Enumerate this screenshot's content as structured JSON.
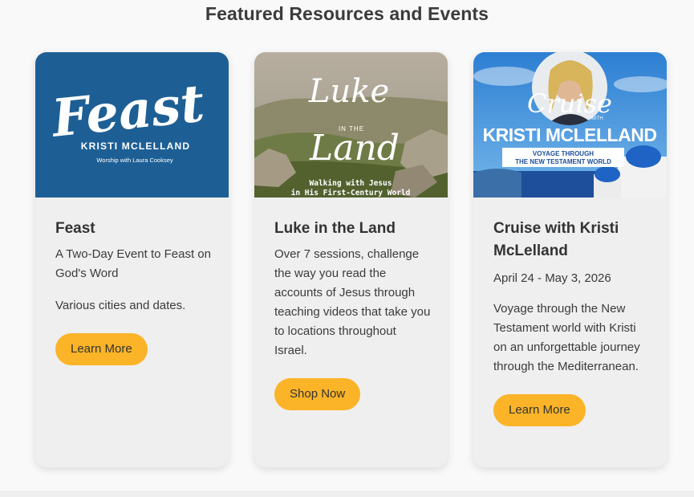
{
  "section": {
    "title": "Featured Resources and Events"
  },
  "cards": [
    {
      "image": {
        "title": "Feast",
        "author": "KRISTI MCLELLAND",
        "subtitle": "Worship with Laura Cooksey",
        "bg": "#1d5f95"
      },
      "title": "Feast",
      "subtitle": "A Two-Day Event to Feast on God's Word",
      "text": "Various cities and dates.",
      "button": "Learn More"
    },
    {
      "image": {
        "title_1": "Luke",
        "title_mid": "IN THE",
        "title_2": "Land",
        "caption_1": "Walking with Jesus",
        "caption_2": "in His First-Century World"
      },
      "title": "Luke in the Land",
      "text": "Over 7 sessions, challenge the way you read the accounts of Jesus through teaching videos that take you to locations throughout Israel.",
      "button": "Shop Now"
    },
    {
      "image": {
        "title_1": "Cruise",
        "title_with": "WITH",
        "title_2": "KRISTI MCLELLAND",
        "banner_1": "VOYAGE THROUGH",
        "banner_2": "THE NEW TESTAMENT WORLD"
      },
      "title": "Cruise with Kristi McLelland",
      "date": "April 24 - May 3, 2026",
      "text": "Voyage through the New Testament world with Kristi on an unforgettable journey through the Mediterranean.",
      "button": "Learn More"
    }
  ],
  "colors": {
    "button": "#fbb428",
    "card_bg": "#efefef",
    "page_bg": "#f9f9f9"
  }
}
